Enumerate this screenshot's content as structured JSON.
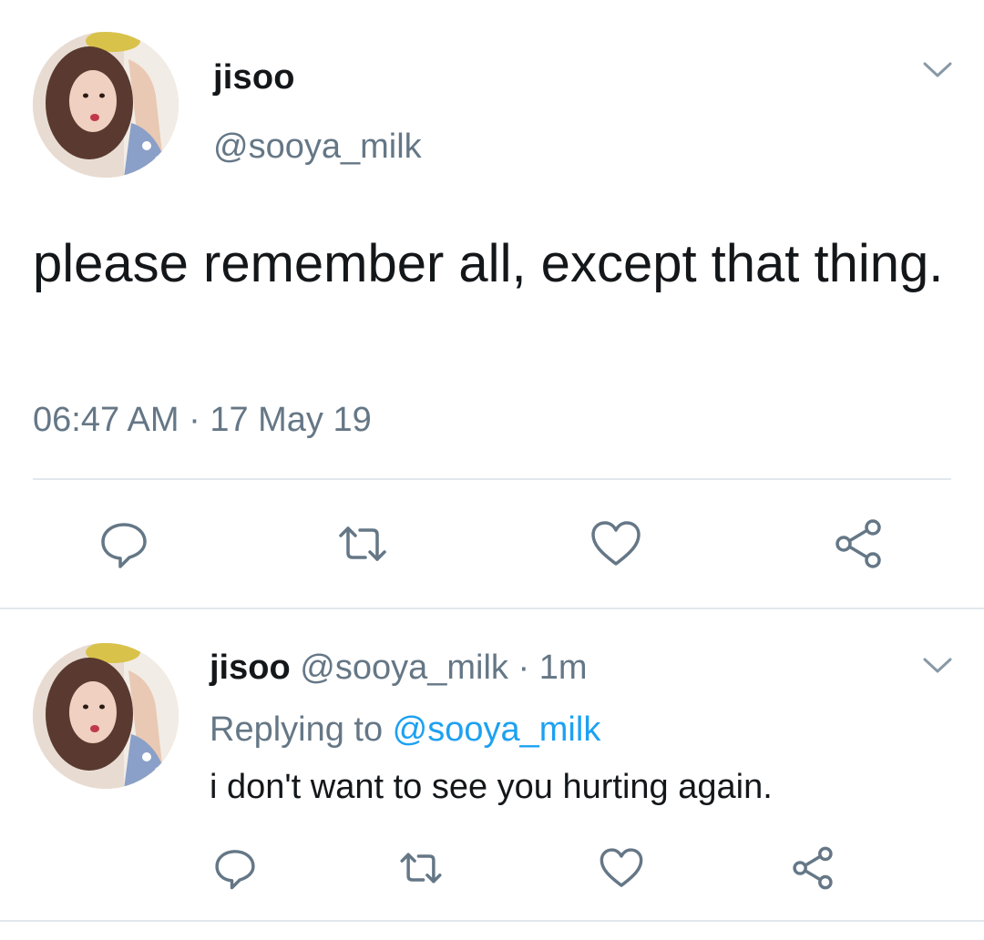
{
  "tweet": {
    "author_name": "jisoo",
    "author_handle": "@sooya_milk",
    "text": "please remember all, except that thing.",
    "timestamp": "06:47 AM · 17 May 19"
  },
  "reply": {
    "author_name": "jisoo",
    "author_handle": "@sooya_milk",
    "separator": " · ",
    "age": "1m",
    "replying_prefix": "Replying to ",
    "replying_mention": "@sooya_milk",
    "text": "i don't want to see you hurting again."
  },
  "icons": {
    "reply": "reply-icon",
    "retweet": "retweet-icon",
    "like": "heart-icon",
    "share": "share-icon",
    "more": "chevron-down-icon"
  },
  "colors": {
    "text_primary": "#14171a",
    "text_secondary": "#657786",
    "link": "#1da1f2",
    "divider": "#e1e8ed",
    "icon": "#657786"
  }
}
